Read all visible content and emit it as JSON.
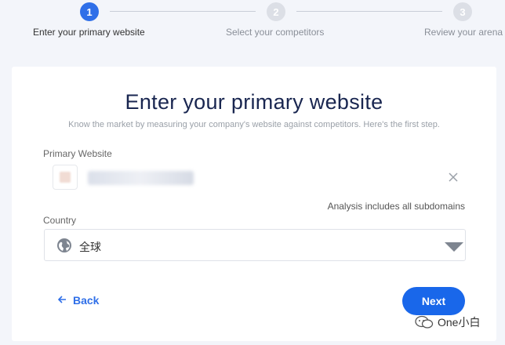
{
  "stepper": {
    "steps": [
      {
        "number": "1",
        "label": "Enter your primary website"
      },
      {
        "number": "2",
        "label": "Select your competitors"
      },
      {
        "number": "3",
        "label": "Review your arena"
      }
    ]
  },
  "card": {
    "title": "Enter your primary website",
    "subtitle": "Know the market by measuring your company's website against competitors. Here's the first step.",
    "website_label": "Primary Website",
    "subdomains_hint": "Analysis includes all subdomains",
    "country_label": "Country",
    "country_value": "全球",
    "back_label": "Back",
    "next_label": "Next"
  },
  "watermark": {
    "text": "One小白"
  },
  "colors": {
    "accent": "#1967ea",
    "title": "#192650",
    "background": "#f3f5fa"
  },
  "icons": [
    "close-icon",
    "globe-icon",
    "chevron-down-icon",
    "arrow-left-icon",
    "wechat-icon"
  ]
}
